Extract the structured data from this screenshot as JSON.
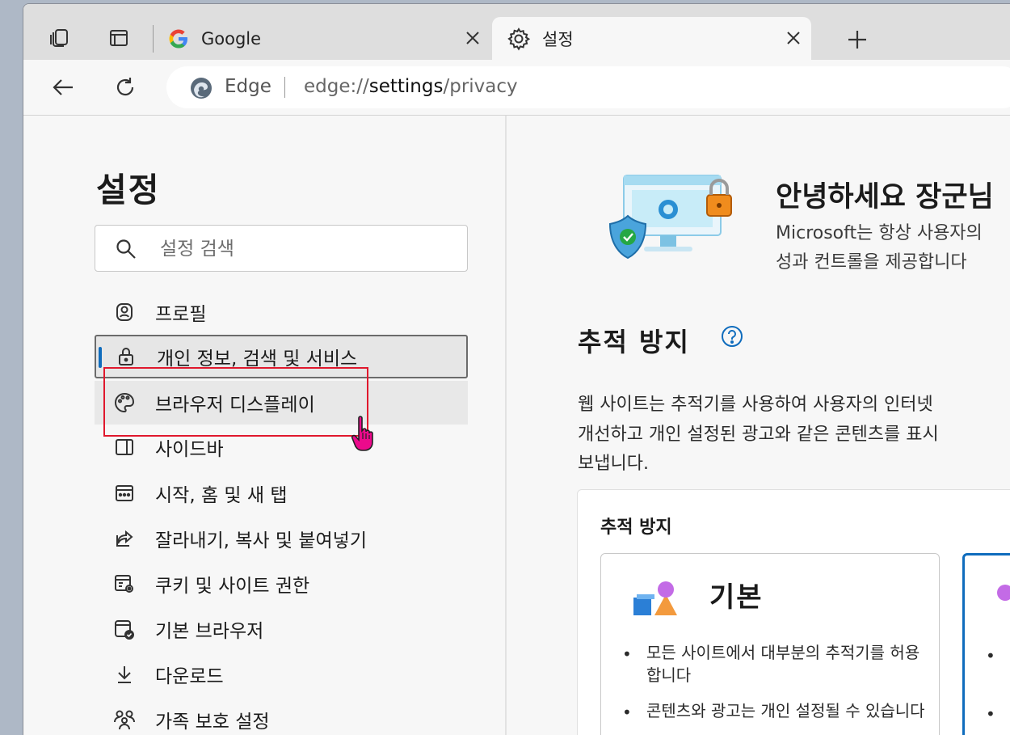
{
  "tabs": [
    {
      "title": "Google",
      "icon": "google-g-icon"
    },
    {
      "title": "설정",
      "icon": "gear-icon"
    }
  ],
  "address": {
    "brand": "Edge",
    "scheme": "edge://",
    "host": "settings",
    "path": "/privacy"
  },
  "sidebar": {
    "title": "설정",
    "search_placeholder": "설정 검색",
    "items": [
      {
        "label": "프로필",
        "icon": "profile-icon"
      },
      {
        "label": "개인 정보, 검색 및 서비스",
        "icon": "lock-icon"
      },
      {
        "label": "브라우저 디스플레이",
        "icon": "palette-icon"
      },
      {
        "label": "사이드바",
        "icon": "sidebar-icon"
      },
      {
        "label": "시작, 홈 및 새 탭",
        "icon": "start-home-icon"
      },
      {
        "label": "잘라내기, 복사 및 붙여넣기",
        "icon": "share-icon"
      },
      {
        "label": "쿠키 및 사이트 권한",
        "icon": "cookie-settings-icon"
      },
      {
        "label": "기본 브라우저",
        "icon": "default-browser-icon"
      },
      {
        "label": "다운로드",
        "icon": "download-icon"
      },
      {
        "label": "가족 보호 설정",
        "icon": "family-icon"
      }
    ]
  },
  "main": {
    "greeting": "안녕하세요 장군님",
    "hero_lines": [
      "Microsoft는 항상 사용자의",
      "성과 컨트롤을 제공합니다"
    ],
    "section_title": "추적 방지",
    "description": [
      "웹 사이트는 추적기를 사용하여 사용자의 인터넷",
      "개선하고 개인 설정된 광고와 같은 콘텐츠를 표시",
      "보냅니다."
    ],
    "card": {
      "title": "추적 방지",
      "option_basic": {
        "name": "기본",
        "bullets": [
          "모든 사이트에서 대부분의 추적기를 허용합니다",
          "콘텐츠와 광고는 개인 설정될 수 있습니다"
        ]
      }
    }
  },
  "colors": {
    "accent": "#0f6cbd",
    "highlight_box": "#e0182d",
    "cursor": "#e5007e"
  }
}
